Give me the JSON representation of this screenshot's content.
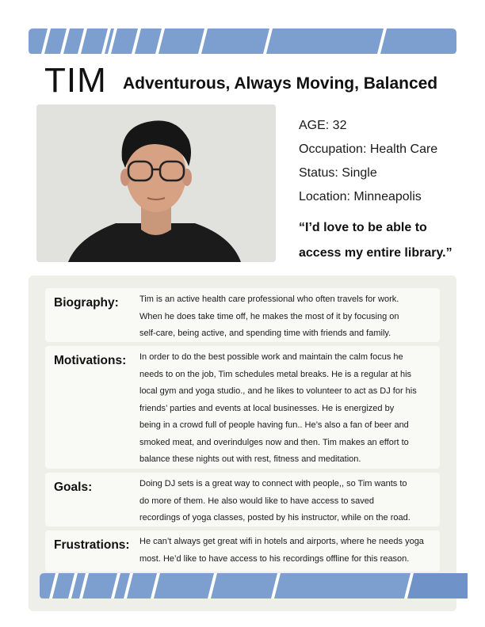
{
  "persona": {
    "name": "TIM",
    "tagline": "Adventurous, Always Moving, Balanced",
    "facts": [
      "AGE: 32",
      "Occupation: Health Care",
      "Status: Single",
      "Location: Minneapolis"
    ],
    "quote_lines": [
      "“I’d love to be able to",
      "access my entire library.”"
    ]
  },
  "sections": [
    {
      "label": "Biography:",
      "lines": [
        "Tim is an active health care professional who often travels for work.",
        "When he does take time off, he makes the most of it by focusing on",
        "self-care, being active, and spending time with friends and family."
      ]
    },
    {
      "label": "Motivations:",
      "lines": [
        "In order to do the best possible work and maintain the calm focus he",
        "needs to on the job, Tim schedules metal breaks.  He is a regular at his",
        "local gym and yoga studio., and he likes to volunteer to act as DJ for his",
        "friends’ parties and events at local businesses.  He is energized by",
        "being in a crowd full of people having fun..  He’s also a fan of beer and",
        "smoked meat, and overindulges now and then.  Tim makes an effort to",
        "balance these nights out with rest, fitness and meditation."
      ]
    },
    {
      "label": "Goals:",
      "lines": [
        "Doing DJ sets is a great way to connect with people,, so Tim wants to",
        "do more of them.  He also would like to have access to saved",
        "recordings of yoga classes, posted by his instructor, while on the road."
      ]
    },
    {
      "label": "Frustrations:",
      "lines": [
        "He can’t always get great wifi in hotels and airports, where he needs yoga",
        "most.  He’d like to have access to his recordings offline for this reason."
      ]
    }
  ],
  "colors": {
    "stripe": "#7c9fd0",
    "stripe_dark": "#6f93c9",
    "panel": "#eeefe9",
    "card": "#f9f9f6"
  },
  "icons": {
    "photo": "portrait-photo"
  }
}
